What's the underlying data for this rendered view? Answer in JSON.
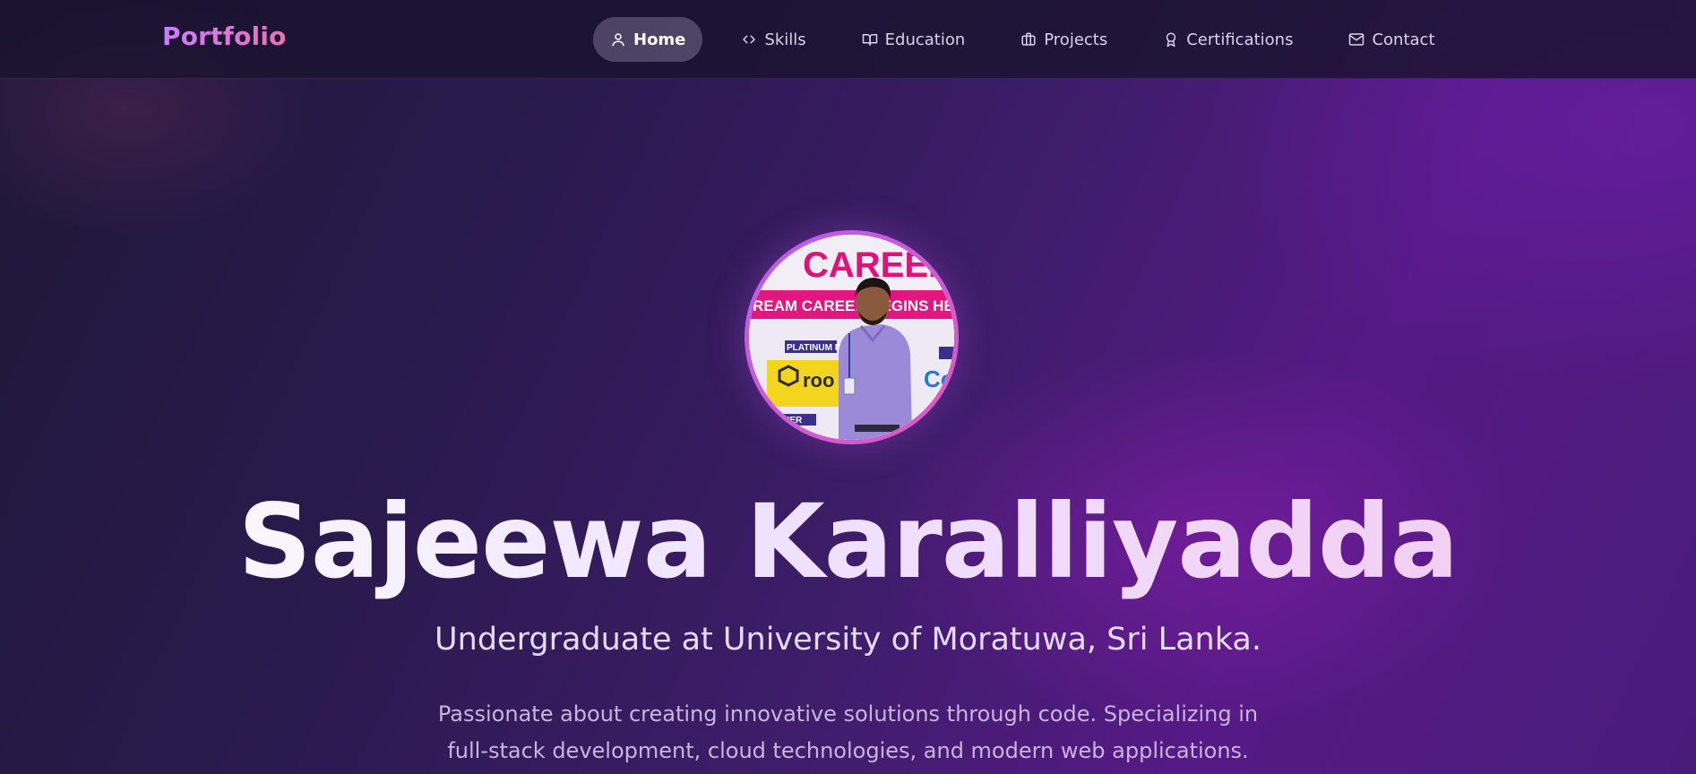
{
  "nav": {
    "logo": "Portfolio",
    "items": [
      {
        "label": "Home",
        "icon": "user-icon",
        "active": true
      },
      {
        "label": "Skills",
        "icon": "code-icon",
        "active": false
      },
      {
        "label": "Education",
        "icon": "book-icon",
        "active": false
      },
      {
        "label": "Projects",
        "icon": "briefcase-icon",
        "active": false
      },
      {
        "label": "Certifications",
        "icon": "award-icon",
        "active": false
      },
      {
        "label": "Contact",
        "icon": "mail-icon",
        "active": false
      }
    ]
  },
  "hero": {
    "name": "Sajeewa Karalliyadda",
    "subtitle": "Undergraduate at University of Moratuwa, Sri Lanka.",
    "description": "Passionate about creating innovative solutions through code. Specializing in full-stack development, cloud technologies, and modern web applications.",
    "photo_text": {
      "banner_top": "CAREERS",
      "banner_strip": "REAM CAREER BEGINS HE",
      "badge": "PLATINUM P",
      "sponsor": "roo",
      "partner": "TNER",
      "sponsor_right": "Co"
    }
  },
  "colors": {
    "accent_purple": "#c77dff",
    "accent_pink": "#f06fb6",
    "active_pill": "#6e6487"
  }
}
